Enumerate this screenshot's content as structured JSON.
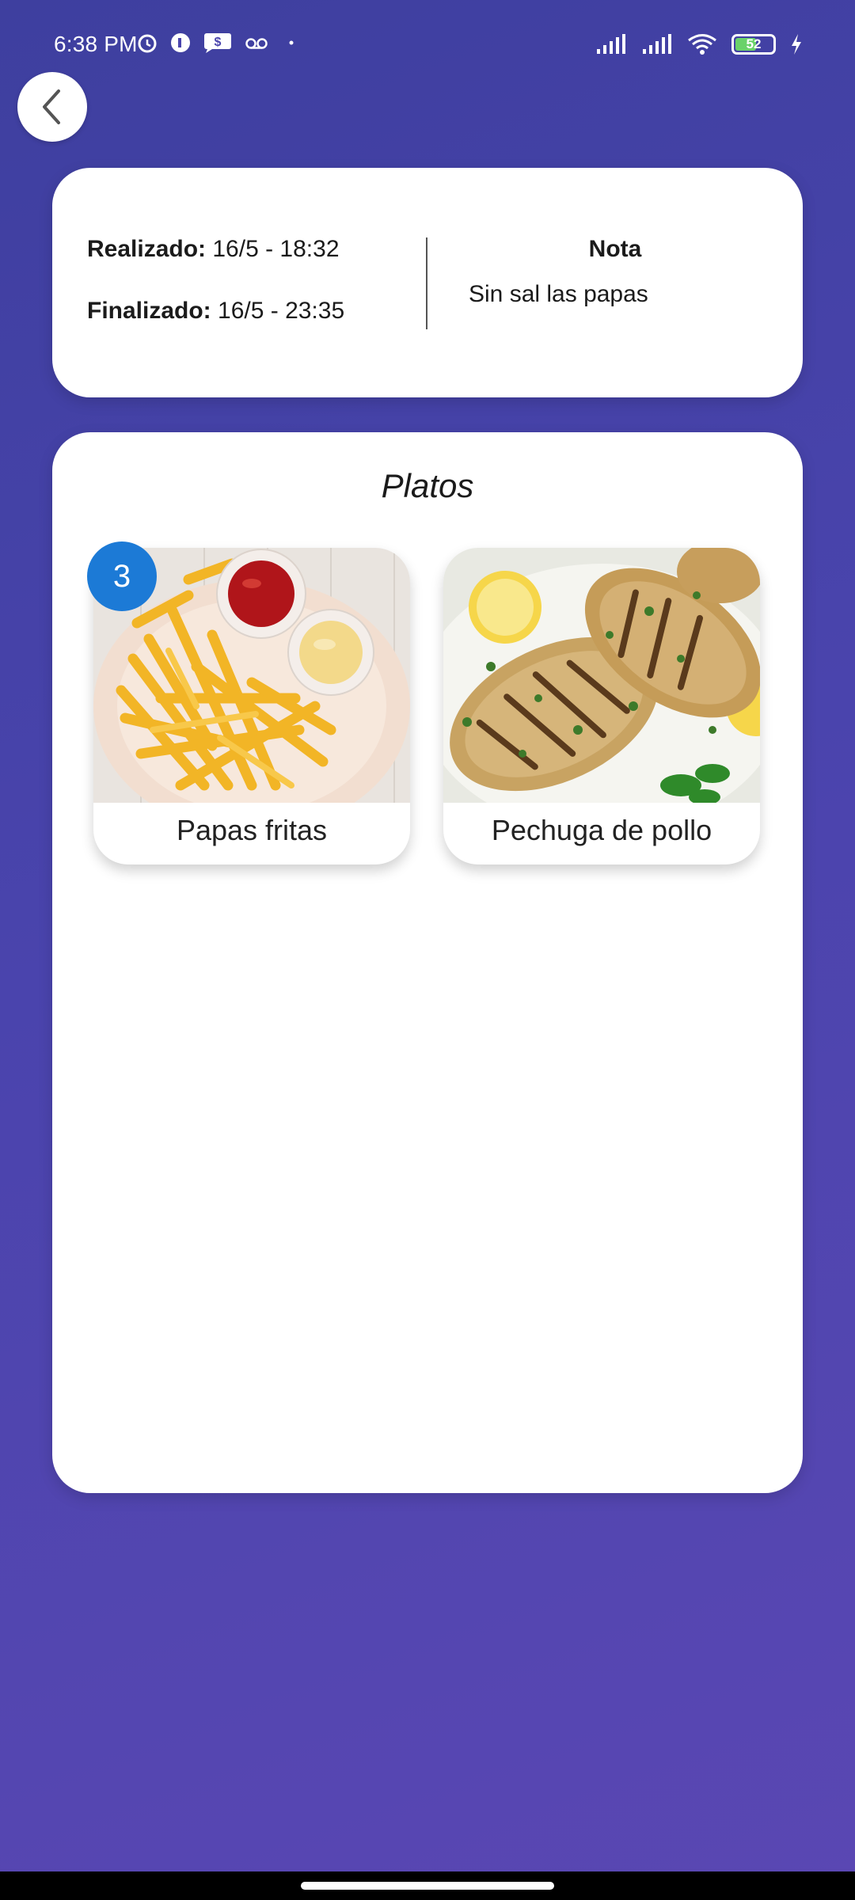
{
  "status_bar": {
    "time": "6:38 PM",
    "icons_left": [
      "alarm-icon",
      "app-icon",
      "message-dollar-icon",
      "voicemail-icon",
      "dot-icon"
    ],
    "icons_right": [
      "signal-1-icon",
      "signal-2-icon",
      "wifi-icon",
      "battery-icon",
      "charging-icon"
    ],
    "battery_level": "52"
  },
  "back_button": {
    "icon": "chevron-left-icon"
  },
  "order_info": {
    "realizado_label": "Realizado:",
    "realizado_value": "16/5 - 18:32",
    "finalizado_label": "Finalizado:",
    "finalizado_value": "16/5 - 23:35",
    "note_title": "Nota",
    "note_text": "Sin sal las papas"
  },
  "platos": {
    "title": "Platos",
    "items": [
      {
        "name": "Papas fritas",
        "quantity": "3"
      },
      {
        "name": "Pechuga de pollo"
      }
    ]
  },
  "colors": {
    "background_start": "#3e3f9f",
    "background_end": "#5a47b3",
    "badge": "#1c7ad6",
    "card": "#ffffff"
  }
}
